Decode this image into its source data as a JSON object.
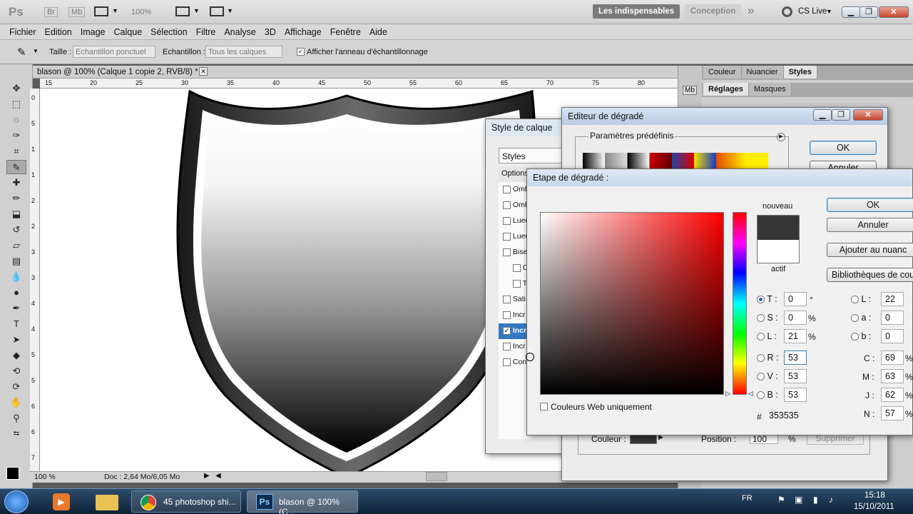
{
  "app": {
    "logo": "Ps",
    "br": "Br",
    "mb": "Mb",
    "zoom": "100%",
    "workspace_active": "Les indispensables",
    "workspace_other": "Conception",
    "overflow": "»",
    "cs_live": "CS Live"
  },
  "menu": [
    "Fichier",
    "Edition",
    "Image",
    "Calque",
    "Sélection",
    "Filtre",
    "Analyse",
    "3D",
    "Affichage",
    "Fenêtre",
    "Aide"
  ],
  "options": {
    "size_label": "Taille :",
    "size_value": "Echantillon ponctuel",
    "sample_label": "Echantillon :",
    "sample_value": "Tous les calques",
    "ring_label": "Afficher l'anneau d'échantillonnage"
  },
  "document": {
    "tab_title": "blason @ 100% (Calque 1 copie 2, RVB/8) *",
    "ruler_h": [
      "15",
      "20",
      "25",
      "30",
      "35",
      "40",
      "45",
      "50",
      "55",
      "60",
      "65",
      "70",
      "75",
      "80"
    ],
    "ruler_v": [
      "0",
      "5",
      "1",
      "1",
      "2",
      "2",
      "3",
      "3",
      "4",
      "4",
      "5",
      "5",
      "6",
      "6",
      "7"
    ],
    "status_zoom": "100 %",
    "status_doc": "Doc : 2,64 Mo/6,05 Mo"
  },
  "panels": {
    "tabs1": [
      "Couleur",
      "Nuancier",
      "Styles"
    ],
    "tabs2": [
      "Réglages",
      "Masques"
    ],
    "strip_label": "Mb"
  },
  "layer_style": {
    "title": "Style de calque",
    "styles_header": "Styles",
    "options_label": "Options",
    "items": [
      {
        "label": "Omb",
        "checked": false
      },
      {
        "label": "Omb",
        "checked": false
      },
      {
        "label": "Lueu",
        "checked": false
      },
      {
        "label": "Lueu",
        "checked": false
      },
      {
        "label": "Bise",
        "checked": false
      },
      {
        "label": "C",
        "checked": false
      },
      {
        "label": "T",
        "checked": false
      },
      {
        "label": "Sati",
        "checked": false
      },
      {
        "label": "Incr",
        "checked": false
      },
      {
        "label": "Incr",
        "checked": true
      },
      {
        "label": "Incr",
        "checked": false
      },
      {
        "label": "Con",
        "checked": false
      }
    ]
  },
  "gradient_editor": {
    "title": "Editeur de dégradé",
    "presets_label": "Paramètres prédéfinis",
    "ok": "OK",
    "cancel": "Annuler",
    "color_label": "Couleur :",
    "position_label": "Position :",
    "position_value": "100",
    "percent": "%",
    "delete": "Supprimer"
  },
  "color_picker": {
    "title": "Etape de dégradé :",
    "new_label": "nouveau",
    "current_label": "actif",
    "new_color": "#353535",
    "current_color": "#ffffff",
    "ok": "OK",
    "cancel": "Annuler",
    "add_swatch": "Ajouter au nuanc",
    "libraries": "Bibliothèques de cou",
    "web_only": "Couleurs Web uniquement",
    "hsb": [
      {
        "label": "T :",
        "value": "0",
        "unit": "°",
        "selected": true
      },
      {
        "label": "S :",
        "value": "0",
        "unit": "%",
        "selected": false
      },
      {
        "label": "L :",
        "value": "21",
        "unit": "%",
        "selected": false
      }
    ],
    "rgb": [
      {
        "label": "R :",
        "value": "53"
      },
      {
        "label": "V :",
        "value": "53"
      },
      {
        "label": "B :",
        "value": "53"
      }
    ],
    "lab": [
      {
        "label": "L :",
        "value": "22"
      },
      {
        "label": "a :",
        "value": "0"
      },
      {
        "label": "b :",
        "value": "0"
      }
    ],
    "cmyk": [
      {
        "label": "C :",
        "value": "69",
        "unit": "%"
      },
      {
        "label": "M :",
        "value": "63",
        "unit": "%"
      },
      {
        "label": "J :",
        "value": "62",
        "unit": "%"
      },
      {
        "label": "N :",
        "value": "57",
        "unit": "%"
      }
    ],
    "hex_label": "#",
    "hex": "353535"
  },
  "taskbar": {
    "chrome_task": "45 photoshop shi...",
    "ps_task": "blason @ 100% (C...",
    "lang": "FR",
    "time": "15:18",
    "date": "15/10/2011"
  },
  "colors": {
    "accent": "#3c7fb1",
    "workspace_active_bg": "#7a7a7a",
    "taskbar": "#1b3653"
  }
}
